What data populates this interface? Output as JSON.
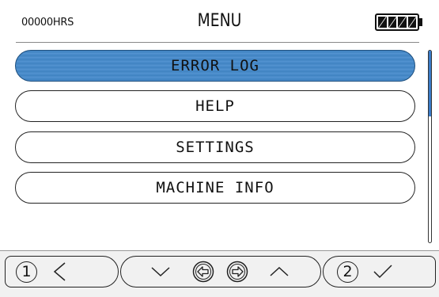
{
  "header": {
    "hours": "00000HRS",
    "title": "MENU",
    "battery_icon": "battery-full-icon"
  },
  "menu": {
    "items": [
      {
        "label": "ERROR LOG",
        "selected": true
      },
      {
        "label": "HELP",
        "selected": false
      },
      {
        "label": "SETTINGS",
        "selected": false
      },
      {
        "label": "MACHINE INFO",
        "selected": false
      }
    ]
  },
  "bottom_bar": {
    "button_1_number": "1",
    "button_2_number": "2",
    "icons": [
      "back-chevron-icon",
      "down-chevron-icon",
      "left-arrow-circle-icon",
      "right-arrow-circle-icon",
      "up-chevron-icon",
      "checkmark-icon"
    ]
  },
  "colors": {
    "selected_item": "#4a8dcb",
    "scroll_thumb": "#3a7bc8",
    "bottom_bar_bg": "#f1f1f1"
  }
}
